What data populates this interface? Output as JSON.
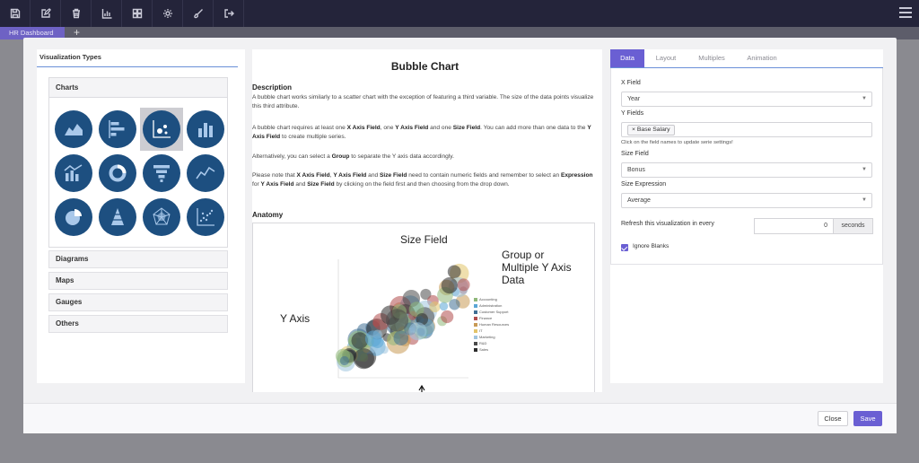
{
  "toolbar": {
    "buttons": [
      "save-icon",
      "edit-icon",
      "trash-icon",
      "bar-chart-icon",
      "dashboard-icon",
      "gear-icon",
      "brush-icon",
      "exit-icon"
    ],
    "menu_icon": "hamburger-menu-icon"
  },
  "tabs": {
    "active_tab": "HR Dashboard",
    "add_symbol": "+"
  },
  "left": {
    "header": "Visualization Types",
    "charts_label": "Charts",
    "chart_icons": [
      "area-chart-icon",
      "horizontal-bar-chart-icon",
      "bubble-chart-icon",
      "column-chart-icon",
      "combo-chart-icon",
      "donut-chart-icon",
      "funnel-chart-icon",
      "line-chart-icon",
      "pie-chart-icon",
      "pyramid-chart-icon",
      "radar-chart-icon",
      "scatter-chart-icon"
    ],
    "selected_icon": "bubble-chart-icon",
    "categories": [
      "Diagrams",
      "Maps",
      "Gauges",
      "Others"
    ]
  },
  "middle": {
    "title": "Bubble Chart",
    "description_heading": "Description",
    "p1": "A bubble chart works similarly to a scatter chart with the exception of featuring a third variable. The size of the data points visualize this third attribute.",
    "p2_parts": [
      "A bubble chart requires at least one ",
      "X Axis Field",
      ", one ",
      "Y Axis Field",
      " and one ",
      "Size Field",
      ". You can add more than one data to the ",
      "Y Axis Field",
      " to create multiple series."
    ],
    "p3_parts": [
      "Alternatively, you can select a ",
      "Group",
      " to separate the Y axis data accordingly."
    ],
    "p4_parts": [
      "Please note that ",
      "X Axis Field",
      ", ",
      "Y Axis Field",
      " and ",
      "Size Field",
      " need to contain numeric fields and remember to select an ",
      "Expression",
      " for ",
      "Y Axis Field",
      " and ",
      "Size Field",
      " by clicking on the field first and then choosing from the drop down."
    ],
    "anatomy_heading": "Anatomy",
    "anatomy": {
      "size_field": "Size Field",
      "group_label": [
        "Group or",
        "Multiple Y Axis",
        "Data"
      ],
      "y_axis": "Y Axis",
      "legend": [
        "Accounting",
        "Administration",
        "Customer Support",
        "Finance",
        "Human Resources",
        "IT",
        "Marketing",
        "R&D",
        "Sales"
      ],
      "legend_colors": [
        "#8fb87a",
        "#5aa6d6",
        "#3f6f94",
        "#b04d4d",
        "#c89a55",
        "#e2c46a",
        "#9fc4de",
        "#4a4a4a",
        "#2b2b2b"
      ]
    }
  },
  "right": {
    "tabs": [
      "Data",
      "Layout",
      "Multiples",
      "Animation"
    ],
    "active_tab": "Data",
    "x_field_label": "X Field",
    "x_field_value": "Year",
    "y_fields_label": "Y Fields",
    "y_field_tag": "Base Salary",
    "y_fields_hint": "Click on the field names to update serie settings!",
    "size_field_label": "Size Field",
    "size_field_value": "Bonus",
    "size_expr_label": "Size Expression",
    "size_expr_value": "Average",
    "refresh_label": "Refresh this visualization in every",
    "refresh_value": "0",
    "refresh_unit": "seconds",
    "ignore_blanks_label": "Ignore Blanks",
    "ignore_blanks_checked": true
  },
  "footer": {
    "close_label": "Close",
    "save_label": "Save"
  },
  "colors": {
    "accent": "#6a5fd3",
    "chart_icon": "#1d4f80",
    "toolbar": "#24243a"
  }
}
